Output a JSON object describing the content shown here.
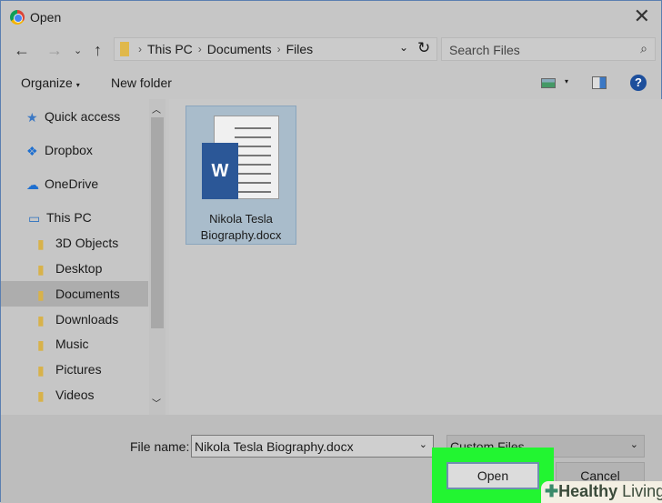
{
  "window": {
    "title": "Open"
  },
  "address": {
    "crumbs": [
      "This PC",
      "Documents",
      "Files"
    ]
  },
  "search": {
    "placeholder": "Search Files"
  },
  "toolbar": {
    "organize": "Organize",
    "new_folder": "New folder"
  },
  "sidebar": {
    "items": [
      {
        "label": "Quick access",
        "icon": "star-icon"
      },
      {
        "label": "Dropbox",
        "icon": "dropbox-icon"
      },
      {
        "label": "OneDrive",
        "icon": "cloud-icon"
      },
      {
        "label": "This PC",
        "icon": "computer-icon"
      },
      {
        "label": "3D Objects",
        "icon": "folder-icon"
      },
      {
        "label": "Desktop",
        "icon": "folder-icon"
      },
      {
        "label": "Documents",
        "icon": "folder-icon",
        "selected": true
      },
      {
        "label": "Downloads",
        "icon": "folder-icon"
      },
      {
        "label": "Music",
        "icon": "folder-icon"
      },
      {
        "label": "Pictures",
        "icon": "folder-icon"
      },
      {
        "label": "Videos",
        "icon": "folder-icon"
      }
    ]
  },
  "files": [
    {
      "name": "Nikola Tesla Biography.docx",
      "icon_letter": "W"
    }
  ],
  "footer": {
    "file_name_label": "File name:",
    "file_name_value": "Nikola Tesla Biography.docx",
    "file_type": "Custom Files",
    "open": "Open",
    "cancel": "Cancel"
  },
  "watermark": {
    "text1": "Healthy",
    "text2": "Living"
  }
}
